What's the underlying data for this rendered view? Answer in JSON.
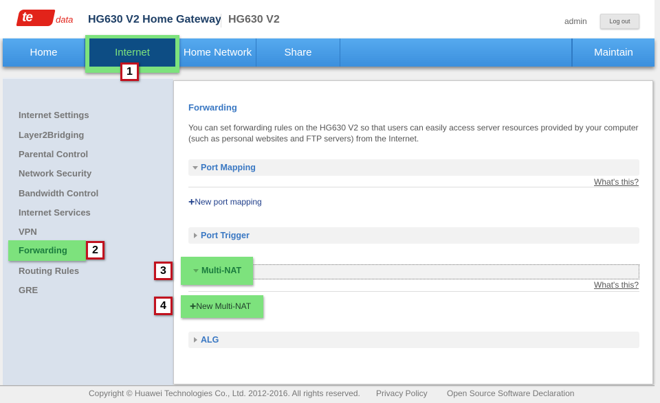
{
  "header": {
    "logo_text": "te",
    "logo_suffix": "data",
    "title": "HG630 V2 Home Gateway",
    "model": "HG630 V2",
    "user": "admin",
    "logout_label": "Log out"
  },
  "nav": {
    "items": [
      {
        "label": "Home"
      },
      {
        "label": "Internet",
        "active": true
      },
      {
        "label": "Home Network"
      },
      {
        "label": "Share"
      },
      {
        "label": "Maintain"
      }
    ]
  },
  "annotations": [
    "1",
    "2",
    "3",
    "4"
  ],
  "sidebar": {
    "items": [
      {
        "label": "Internet Settings"
      },
      {
        "label": "Layer2Bridging"
      },
      {
        "label": "Parental Control"
      },
      {
        "label": "Network Security"
      },
      {
        "label": "Bandwidth Control"
      },
      {
        "label": "Internet Services"
      },
      {
        "label": "VPN"
      },
      {
        "label": "Forwarding",
        "active": true
      },
      {
        "label": "Routing Rules"
      },
      {
        "label": "GRE"
      }
    ]
  },
  "content": {
    "title": "Forwarding",
    "description": "You can set forwarding rules on the HG630 V2 so that users can easily access server resources provided by your computer (such as personal websites and FTP servers) from the Internet.",
    "sections": [
      {
        "label": "Port Mapping",
        "expanded": true,
        "help": "What's this?",
        "action": "New port mapping"
      },
      {
        "label": "Port Trigger",
        "expanded": false
      },
      {
        "label": "Multi-NAT",
        "expanded": true,
        "help": "What's this?",
        "action": "New Multi-NAT"
      },
      {
        "label": "ALG",
        "expanded": false
      }
    ]
  },
  "footer": {
    "copyright": "Copyright © Huawei Technologies Co., Ltd. 2012-2016. All rights reserved.",
    "privacy": "Privacy Policy",
    "open_source": "Open Source Software Declaration"
  },
  "colors": {
    "brand_red": "#e2231a",
    "nav_blue": "#4a9de8",
    "nav_active": "#0d4d84",
    "highlight_green": "#7de27d",
    "annotation_red": "#c1121f",
    "link_blue": "#3a78c3"
  }
}
